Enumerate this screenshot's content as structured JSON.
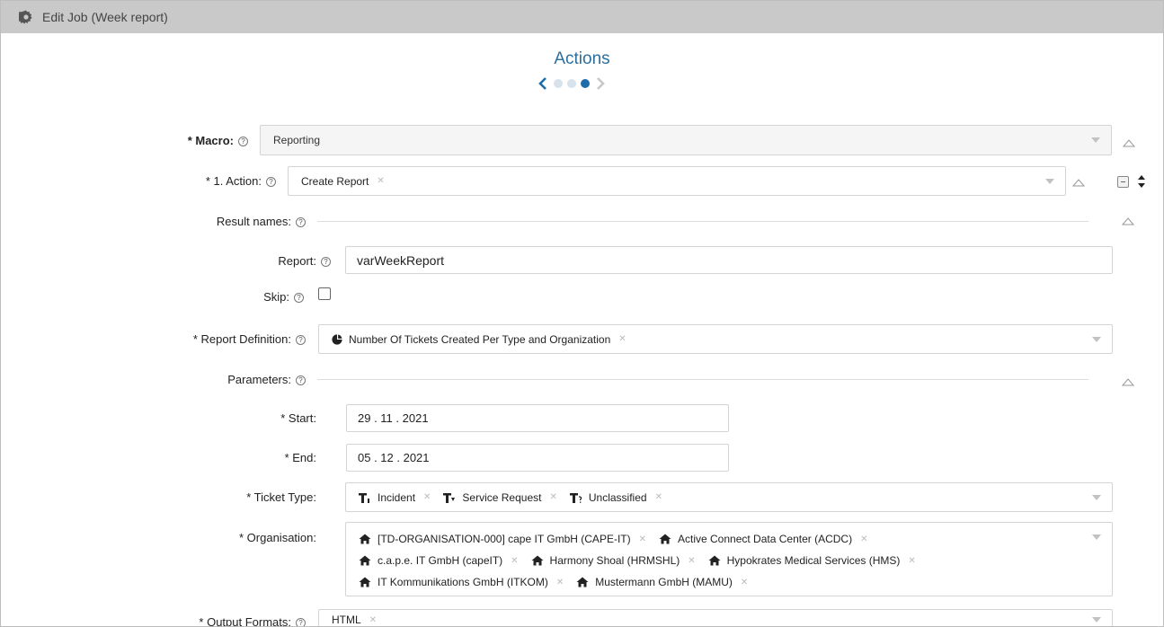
{
  "window": {
    "title": "Edit Job (Week report)",
    "icon": "gear-icon"
  },
  "step": {
    "title": "Actions",
    "total": 3,
    "current": 3
  },
  "macro": {
    "label": "* Macro:",
    "value": "Reporting"
  },
  "action": {
    "label": "* 1. Action:",
    "value": "Create Report"
  },
  "result_names": {
    "label": "Result names:"
  },
  "report": {
    "label": "Report:",
    "value": "varWeekReport"
  },
  "skip": {
    "label": "Skip:",
    "checked": false
  },
  "report_definition": {
    "label": "* Report Definition:",
    "value": "Number Of Tickets Created Per Type and Organization",
    "icon": "pie-chart-icon"
  },
  "parameters": {
    "label": "Parameters:"
  },
  "start": {
    "label": "* Start:",
    "value": "29 . 11 . 2021"
  },
  "end": {
    "label": "* End:",
    "value": "05 . 12 . 2021"
  },
  "ticket_type": {
    "label": "* Ticket Type:",
    "items": [
      {
        "label": "Incident",
        "icon": "ticket-type-incident-icon"
      },
      {
        "label": "Service Request",
        "icon": "ticket-type-service-request-icon"
      },
      {
        "label": "Unclassified",
        "icon": "ticket-type-unclassified-icon"
      }
    ]
  },
  "organisation": {
    "label": "* Organisation:",
    "items": [
      "[TD-ORGANISATION-000] cape IT GmbH (CAPE-IT)",
      "Active Connect Data Center (ACDC)",
      "c.a.p.e. IT GmbH (capeIT)",
      "Harmony Shoal (HRMSHL)",
      "Hypokrates Medical Services (HMS)",
      "IT Kommunikations GmbH (ITKOM)",
      "Mustermann GmbH (MAMU)"
    ]
  },
  "output_formats": {
    "label": "* Output Formats:",
    "value": "HTML"
  },
  "colors": {
    "accent": "#1f6da8",
    "title_bar": "#c9c9c9"
  }
}
